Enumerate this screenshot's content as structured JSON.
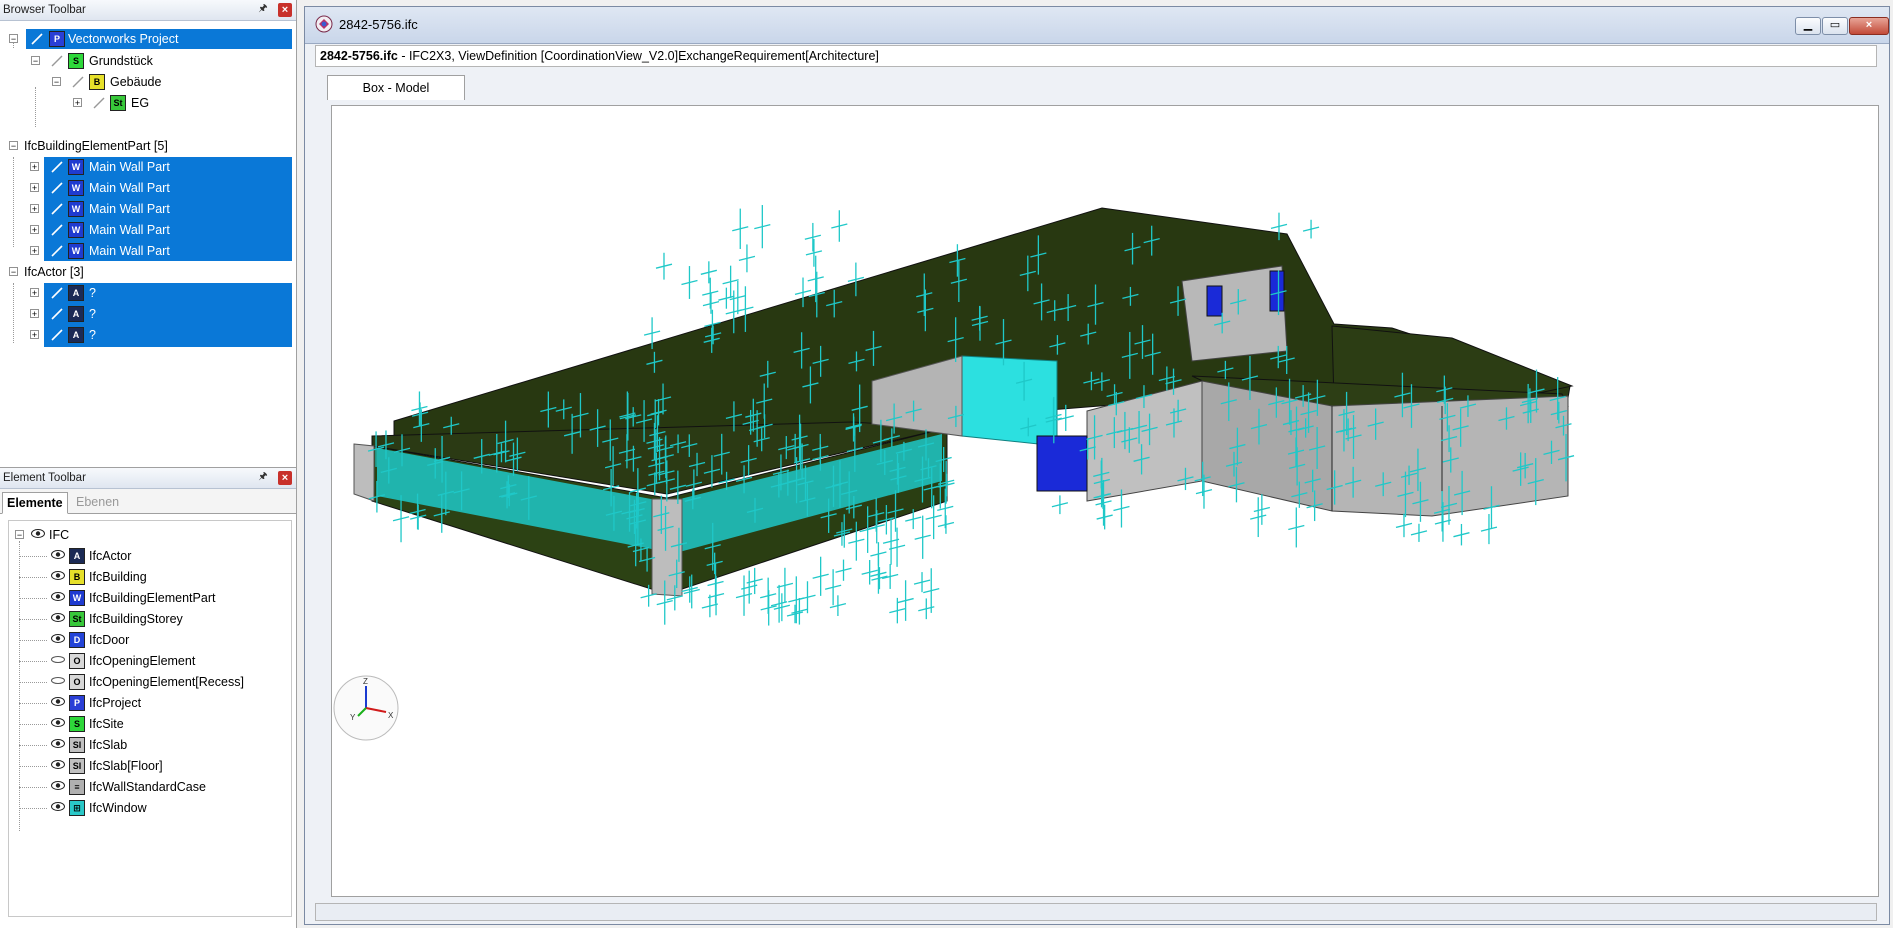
{
  "browser_toolbar": {
    "title": "Browser Toolbar",
    "rows": [
      {
        "label": "Vectorworks Project",
        "icon": "project-icon"
      },
      {
        "label": "Grundstück",
        "icon": "site-icon"
      },
      {
        "label": "Gebäude",
        "icon": "building-icon"
      },
      {
        "label": "EG",
        "icon": "storey-icon"
      },
      {
        "label": "IfcBuildingElementPart [5]"
      },
      {
        "label": "Main Wall Part",
        "icon": "wall-part-icon"
      },
      {
        "label": "Main Wall Part",
        "icon": "wall-part-icon"
      },
      {
        "label": "Main Wall Part",
        "icon": "wall-part-icon"
      },
      {
        "label": "Main Wall Part",
        "icon": "wall-part-icon"
      },
      {
        "label": "Main Wall Part",
        "icon": "wall-part-icon"
      },
      {
        "label": "IfcActor [3]"
      },
      {
        "label": "?",
        "icon": "actor-icon"
      },
      {
        "label": "?",
        "icon": "actor-icon"
      },
      {
        "label": "?",
        "icon": "actor-icon"
      }
    ]
  },
  "element_toolbar": {
    "title": "Element Toolbar",
    "tabs": [
      "Elemente",
      "Ebenen"
    ],
    "root": "IFC",
    "items": [
      {
        "label": "IfcActor",
        "icon": "actor-icon",
        "visible": true
      },
      {
        "label": "IfcBuilding",
        "icon": "building-icon",
        "visible": true
      },
      {
        "label": "IfcBuildingElementPart",
        "icon": "wall-part-icon",
        "visible": true
      },
      {
        "label": "IfcBuildingStorey",
        "icon": "storey-icon",
        "visible": true
      },
      {
        "label": "IfcDoor",
        "icon": "door-icon",
        "visible": true
      },
      {
        "label": "IfcOpeningElement",
        "icon": "opening-icon",
        "visible": false
      },
      {
        "label": "IfcOpeningElement[Recess]",
        "icon": "opening-icon",
        "visible": false
      },
      {
        "label": "IfcProject",
        "icon": "project-icon",
        "visible": true
      },
      {
        "label": "IfcSite",
        "icon": "site-icon",
        "visible": true
      },
      {
        "label": "IfcSlab",
        "icon": "slab-icon",
        "visible": true
      },
      {
        "label": "IfcSlab[Floor]",
        "icon": "slab-icon",
        "visible": true
      },
      {
        "label": "IfcWallStandardCase",
        "icon": "wall-icon",
        "visible": true
      },
      {
        "label": "IfcWindow",
        "icon": "window-icon",
        "visible": true
      }
    ]
  },
  "document": {
    "title": "2842-5756.ifc",
    "info_file": "2842-5756.ifc",
    "info_rest": " - IFC2X3, ViewDefinition [CoordinationView_V2.0]ExchangeRequirement[Architecture]",
    "view_tab": "Box - Model"
  },
  "colors": {
    "selection": "#0a78d7",
    "roof": "#2a3a12",
    "facade_cyan": "#1fc8c8",
    "wall_gray": "#b8b8b8",
    "window_blue": "#1a2ad8"
  },
  "axis_labels": {
    "z": "Z",
    "x": "X",
    "y": "Y"
  }
}
